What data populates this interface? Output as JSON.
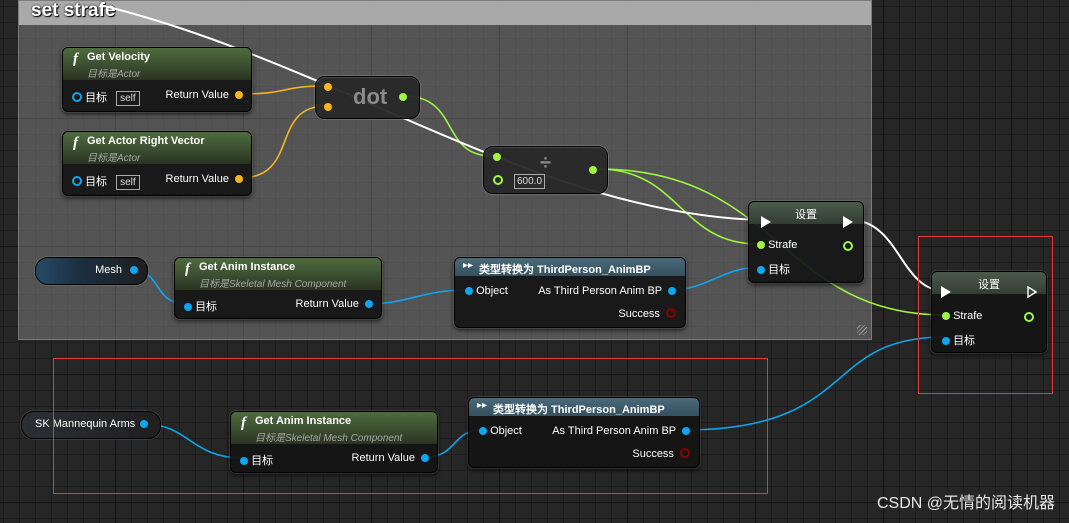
{
  "comment": {
    "title": "set strafe"
  },
  "nodes": {
    "get_velocity": {
      "title": "Get Velocity",
      "subtitle": "目标是Actor",
      "target_label": "目标",
      "self_value": "self",
      "return_label": "Return Value"
    },
    "get_right_vector": {
      "title": "Get Actor Right Vector",
      "subtitle": "目标是Actor",
      "target_label": "目标",
      "self_value": "self",
      "return_label": "Return Value"
    },
    "dot": {
      "label": "dot"
    },
    "divide": {
      "symbol": "÷",
      "value": "600.0"
    },
    "mesh_var": {
      "label": "Mesh"
    },
    "arms_var": {
      "label": "SK Mannequin Arms"
    },
    "anim_instance_1": {
      "title": "Get Anim Instance",
      "subtitle": "目标是Skeletal Mesh Component",
      "target_label": "目标",
      "return_label": "Return Value"
    },
    "anim_instance_2": {
      "title": "Get Anim Instance",
      "subtitle": "目标是Skeletal Mesh Component",
      "target_label": "目标",
      "return_label": "Return Value"
    },
    "cast_1": {
      "title": "类型转换为 ThirdPerson_AnimBP",
      "object_label": "Object",
      "as_label": "As Third Person Anim BP",
      "success_label": "Success"
    },
    "cast_2": {
      "title": "类型转换为 ThirdPerson_AnimBP",
      "object_label": "Object",
      "as_label": "As Third Person Anim BP",
      "success_label": "Success"
    },
    "set_1": {
      "title": "设置",
      "strafe_label": "Strafe",
      "target_label": "目标"
    },
    "set_2": {
      "title": "设置",
      "strafe_label": "Strafe",
      "target_label": "目标"
    }
  },
  "watermark": "CSDN @无情的阅读机器",
  "colors": {
    "vector_pin": "#f6b51d",
    "float_pin": "#9ef542",
    "object_pin": "#0ea6f0",
    "bool_pin": "#8c0000",
    "exec_pin": "#ffffff",
    "selection_outline": "#e03a3a",
    "function_header": "#4f6b3e",
    "cast_header": "#4a6a7a"
  }
}
